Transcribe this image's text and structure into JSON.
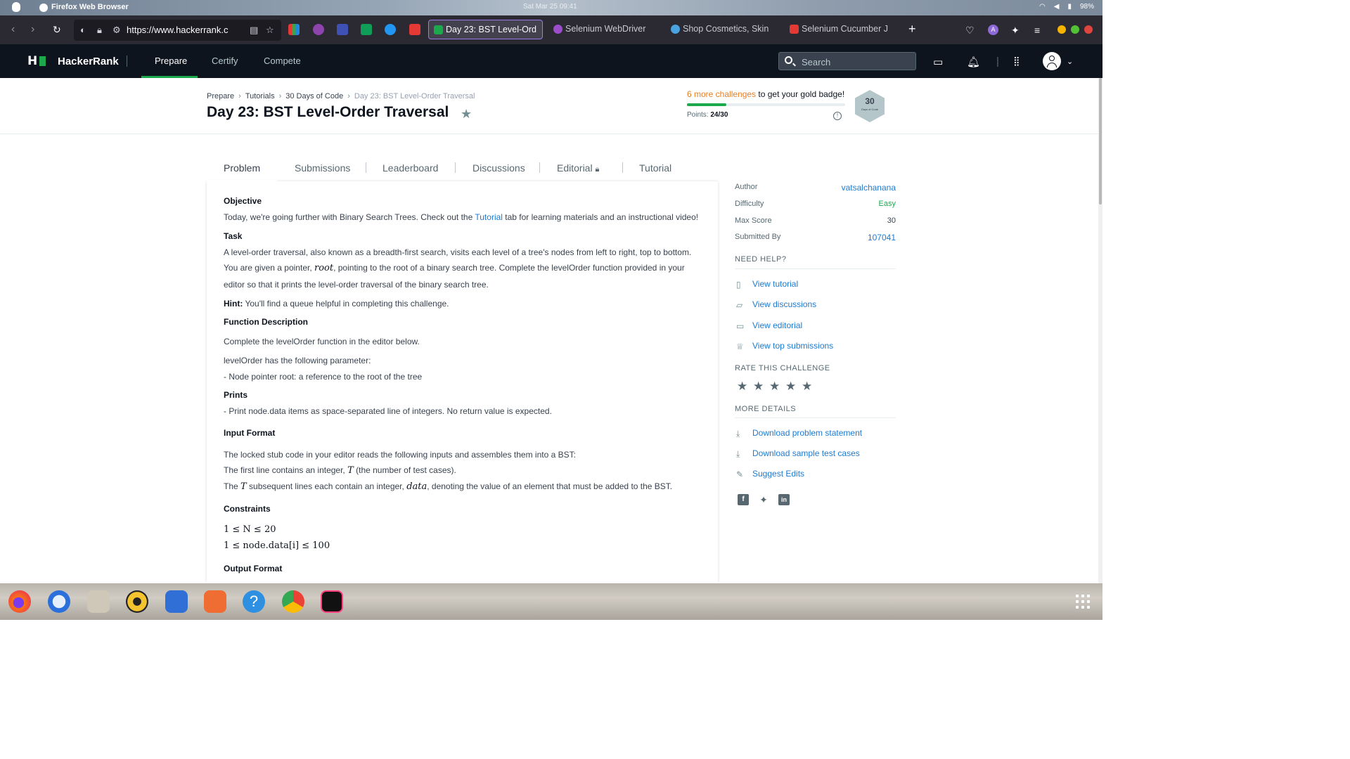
{
  "os": {
    "app_name": "Firefox Web Browser",
    "clock": "Sat Mar 25  09:41",
    "battery": "98%"
  },
  "browser": {
    "url_prefix": "https://www.",
    "url_domain": "hackerrank.c",
    "tabs": [
      {
        "label": "Day 23: BST Level-Ord",
        "color": "#1ba94c",
        "active": true
      },
      {
        "label": "Selenium WebDriver ",
        "color": "#9b4dca",
        "active": false
      },
      {
        "label": "Shop Cosmetics, Skin",
        "color": "#4aa3df",
        "active": false
      },
      {
        "label": "Selenium Cucumber J",
        "color": "#e53935",
        "active": false
      }
    ],
    "new_tab": "+"
  },
  "hr_nav": {
    "brand": "HackerRank",
    "items": [
      "Prepare",
      "Certify",
      "Compete"
    ],
    "search_placeholder": "Search"
  },
  "header": {
    "breadcrumbs": [
      "Prepare",
      "Tutorials",
      "30 Days of Code",
      "Day 23: BST Level-Order Traversal"
    ],
    "title": "Day 23: BST Level-Order Traversal",
    "badge_link": "6 more challenges",
    "badge_rest": " to get your gold badge!",
    "points_label": "Points: ",
    "points_value": "24/30",
    "progress": 0.25,
    "hex_number": "30",
    "hex_sub": "Days of Code"
  },
  "tabs": [
    "Problem",
    "Submissions",
    "Leaderboard",
    "Discussions",
    "Editorial",
    "Tutorial"
  ],
  "problem": {
    "objective_h": "Objective",
    "objective_1": "Today, we're going further with Binary Search Trees. Check out the ",
    "objective_link": "Tutorial",
    "objective_2": " tab for learning materials and an instructional video!",
    "task_h": "Task",
    "task_1": "A level-order traversal, also known as a breadth-first search, visits each level of a tree's nodes from left to right, top to bottom.",
    "task_2a": "You are given a pointer, ",
    "task_2m": "root",
    "task_2b": ", pointing to the root of a binary search tree. Complete the levelOrder function provided in your",
    "task_3": "editor so that it prints the level-order traversal of the binary search tree.",
    "hint_b": "Hint:",
    "hint": " You'll find a queue helpful in completing this challenge.",
    "fd_h": "Function Description",
    "fd_1": "Complete the levelOrder function in the editor below.",
    "fd_2": "levelOrder has the following parameter:",
    "fd_3": "- Node pointer root: a reference to the root of the tree",
    "prints_h": "Prints",
    "prints_1": "- Print node.data items as space-separated line of integers. No return value is expected.",
    "input_h": "Input Format",
    "input_1": "The locked stub code in your editor reads the following inputs and assembles them into a BST:",
    "input_2a": "The first line contains an integer, ",
    "input_2m": "T",
    "input_2b": " (the number of test cases).",
    "input_3a": "The ",
    "input_3m": "T",
    "input_3b": " subsequent lines each contain an integer, ",
    "input_3m2": "data",
    "input_3c": ", denoting the value of an element that must be added to the BST.",
    "constraints_h": "Constraints",
    "c1": "1 ≤ N ≤ 20",
    "c2": "1 ≤ node.data[i] ≤ 100",
    "output_h": "Output Format"
  },
  "sidebar": {
    "details": [
      {
        "k": "Author",
        "v": "vatsalchanana"
      },
      {
        "k": "Difficulty",
        "v": "Easy"
      },
      {
        "k": "Max Score",
        "v": "30"
      },
      {
        "k": "Submitted By",
        "v": "107041"
      }
    ],
    "need_help": "NEED HELP?",
    "help_links": [
      "View tutorial",
      "View discussions",
      "View editorial",
      "View top submissions"
    ],
    "rate": "RATE THIS CHALLENGE",
    "more": "MORE DETAILS",
    "more_links": [
      "Download problem statement",
      "Download sample test cases",
      "Suggest Edits"
    ]
  },
  "colors": {
    "accent_green": "#1ba94c",
    "link_blue": "#1d7ad1",
    "badge_orange": "#e67e22",
    "nav_dark": "#0e141e"
  }
}
